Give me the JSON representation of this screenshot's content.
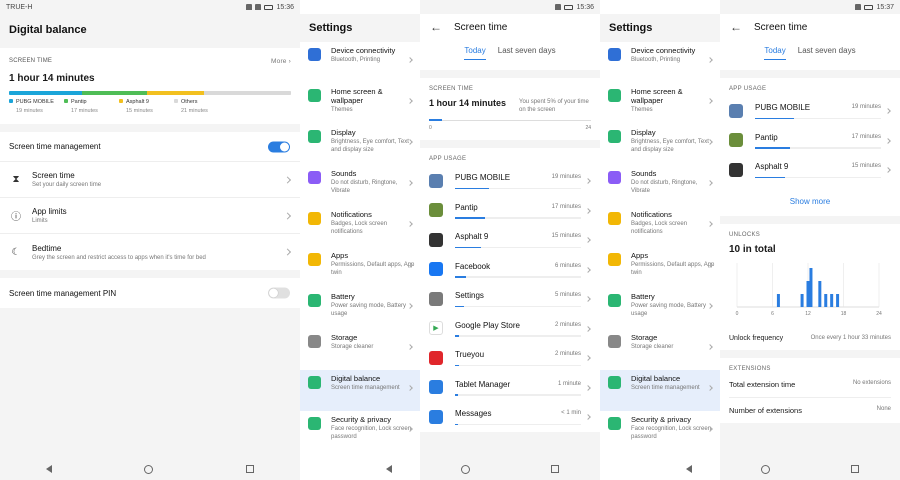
{
  "status": {
    "carrier": "TRUE-H",
    "time1": "15:36",
    "time2": "15:36",
    "time3": "15:37"
  },
  "colors": {
    "accent": "#2a7de0",
    "pubg": "#1ba5d9",
    "pantip": "#4fbd56",
    "asphalt": "#f2c01f",
    "others": "#d9d9d9"
  },
  "p1": {
    "title": "Digital balance",
    "screen_time_label": "SCREEN TIME",
    "more": "More",
    "total": "1 hour 14 minutes",
    "breakdown": [
      {
        "name": "PUBG MOBILE",
        "time": "19 minutes",
        "frac": 0.26,
        "color": "#1ba5d9"
      },
      {
        "name": "Pantip",
        "time": "17 minutes",
        "frac": 0.23,
        "color": "#4fbd56"
      },
      {
        "name": "Asphalt 9",
        "time": "15 minutes",
        "frac": 0.2,
        "color": "#f2c01f"
      },
      {
        "name": "Others",
        "time": "21 minutes",
        "frac": 0.31,
        "color": "#d9d9d9"
      }
    ],
    "management_label": "Screen time management",
    "management_on": true,
    "items": [
      {
        "title": "Screen time",
        "sub": "Set your daily screen time",
        "icon": "hourglass-icon",
        "glyph": "⧗"
      },
      {
        "title": "App limits",
        "sub": "Limits",
        "icon": "alert-icon",
        "glyph": "ⓘ"
      },
      {
        "title": "Bedtime",
        "sub": "Grey the screen and restrict access to apps when it's time for bed",
        "icon": "moon-icon",
        "glyph": "☾"
      }
    ],
    "pin_label": "Screen time management PIN",
    "pin_on": false
  },
  "settings": {
    "title": "Settings",
    "items": [
      {
        "title": "Device connectivity",
        "sub": "Bluetooth, Printing",
        "color": "#2f6fd6",
        "icon": "device-connectivity-icon"
      },
      {
        "title": "Home screen & wallpaper",
        "sub": "Themes",
        "color": "#2bb673",
        "icon": "wallpaper-icon"
      },
      {
        "title": "Display",
        "sub": "Brightness, Eye comfort, Text and display size",
        "color": "#2bb673",
        "icon": "display-icon"
      },
      {
        "title": "Sounds",
        "sub": "Do not disturb, Ringtone, Vibrate",
        "color": "#8b5cf6",
        "icon": "sound-icon"
      },
      {
        "title": "Notifications",
        "sub": "Badges, Lock screen notifications",
        "color": "#f2b705",
        "icon": "notification-icon"
      },
      {
        "title": "Apps",
        "sub": "Permissions, Default apps, App twin",
        "color": "#f2b705",
        "icon": "apps-icon"
      },
      {
        "title": "Battery",
        "sub": "Power saving mode, Battery usage",
        "color": "#2bb673",
        "icon": "battery-icon"
      },
      {
        "title": "Storage",
        "sub": "Storage cleaner",
        "color": "#888888",
        "icon": "storage-icon"
      },
      {
        "title": "Digital balance",
        "sub": "Screen time management",
        "color": "#2bb673",
        "icon": "digital-balance-icon"
      },
      {
        "title": "Security & privacy",
        "sub": "Face recognition, Lock screen password",
        "color": "#2bb673",
        "icon": "security-icon"
      }
    ]
  },
  "screen_time": {
    "title": "Screen time",
    "tab_today": "Today",
    "tab_week": "Last seven days",
    "st_label": "SCREEN TIME",
    "st_value": "1 hour 14 minutes",
    "st_note": "You spent 5% of your time on the screen",
    "st_frac": 0.05,
    "scale_start": "0",
    "scale_end": "24",
    "app_usage_label": "APP USAGE",
    "apps": [
      {
        "name": "PUBG MOBILE",
        "time": "19 minutes",
        "frac": 0.19,
        "color": "#5a7fb0",
        "icon": "pubg-icon"
      },
      {
        "name": "Pantip",
        "time": "17 minutes",
        "frac": 0.17,
        "color": "#6b8e3b",
        "icon": "pantip-icon"
      },
      {
        "name": "Asphalt 9",
        "time": "15 minutes",
        "frac": 0.15,
        "color": "#333333",
        "icon": "asphalt-icon"
      },
      {
        "name": "Facebook",
        "time": "6 minutes",
        "frac": 0.06,
        "color": "#1877f2",
        "icon": "facebook-icon"
      },
      {
        "name": "Settings",
        "time": "5 minutes",
        "frac": 0.05,
        "color": "#7a7a7a",
        "icon": "settings-icon"
      },
      {
        "name": "Google Play Store",
        "time": "2 minutes",
        "frac": 0.02,
        "color": "#ffffff",
        "icon": "play-store-icon"
      },
      {
        "name": "Trueyou",
        "time": "2 minutes",
        "frac": 0.02,
        "color": "#e0262b",
        "icon": "trueyou-icon"
      },
      {
        "name": "Tablet Manager",
        "time": "1 minute",
        "frac": 0.01,
        "color": "#2a7de0",
        "icon": "tablet-manager-icon"
      },
      {
        "name": "Messages",
        "time": "< 1 min",
        "frac": 0.005,
        "color": "#2a7de0",
        "icon": "messages-icon"
      }
    ]
  },
  "screen_time2": {
    "app_usage_label": "APP USAGE",
    "apps": [
      {
        "name": "PUBG MOBILE",
        "time": "19 minutes",
        "frac": 0.26,
        "color": "#5a7fb0",
        "icon": "pubg-icon"
      },
      {
        "name": "Pantip",
        "time": "17 minutes",
        "frac": 0.23,
        "color": "#6b8e3b",
        "icon": "pantip-icon"
      },
      {
        "name": "Asphalt 9",
        "time": "15 minutes",
        "frac": 0.2,
        "color": "#333333",
        "icon": "asphalt-icon"
      }
    ],
    "show_more": "Show more",
    "unlocks_label": "UNLOCKS",
    "unlocks_total": "10 in total",
    "unlock_freq_label": "Unlock frequency",
    "unlock_freq_value": "Once every 1 hour 33 minutes",
    "extensions_label": "EXTENSIONS",
    "total_ext_label": "Total extension time",
    "total_ext_value": "No extensions",
    "num_ext_label": "Number of extensions",
    "num_ext_value": "None"
  },
  "chart_data": {
    "type": "bar",
    "x_ticks": [
      "0",
      "6",
      "12",
      "18",
      "24"
    ],
    "xlim": [
      0,
      24
    ],
    "hours": [
      7,
      11,
      12,
      12.5,
      14,
      15,
      16,
      17
    ],
    "values": [
      1,
      1,
      2,
      3,
      2,
      1,
      1,
      1
    ]
  }
}
